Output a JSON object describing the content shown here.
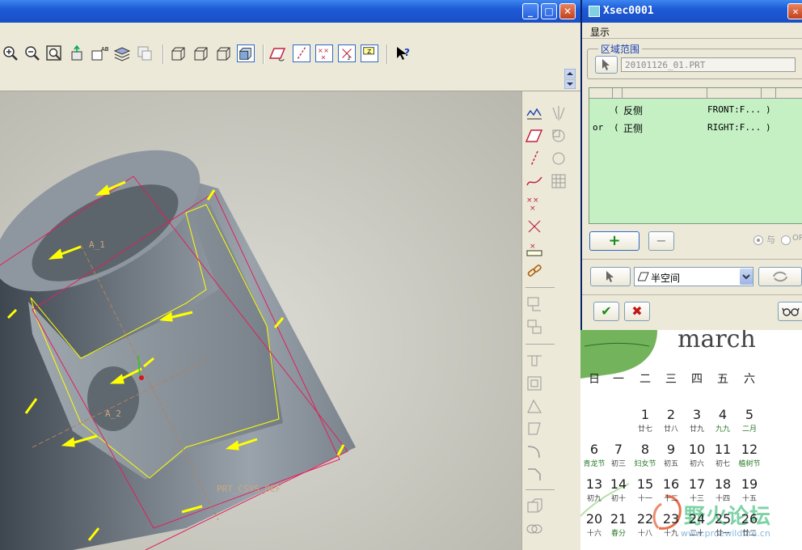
{
  "main_window": {
    "controls": {
      "min": "_",
      "max": "□",
      "close": "✕"
    }
  },
  "viewport": {
    "labels": {
      "datum_a1": "A_1",
      "datum_a2": "A_2",
      "csys": "PRT_CSYS_DEF"
    },
    "colors": {
      "accent_yellow": "#ffff00",
      "outline_red": "#e0205a",
      "body": "#8a929a"
    }
  },
  "dialog": {
    "title": "Xsec0001",
    "menu": "显示",
    "group_label": "区域范围",
    "part_field": "20101126_01.PRT",
    "rows": [
      {
        "op": "",
        "paren": "(",
        "side": "反侧",
        "ref": "FRONT:F...",
        "close": ")"
      },
      {
        "op": "or",
        "paren": "(",
        "side": "正侧",
        "ref": "RIGHT:F...",
        "close": ")"
      }
    ],
    "add_label": "+",
    "remove_label": "−",
    "radio_and": "与",
    "radio_or": "OR",
    "halfspace": "半空间",
    "ok": "✔",
    "cancel": "✖"
  },
  "calendar": {
    "month": "march",
    "weekdays": [
      "日",
      "一",
      "二",
      "三",
      "四",
      "五",
      "六"
    ],
    "weeks": [
      [
        {
          "d": "",
          "s": ""
        },
        {
          "d": "",
          "s": ""
        },
        {
          "d": "1",
          "s": "廿七"
        },
        {
          "d": "2",
          "s": "廿八"
        },
        {
          "d": "3",
          "s": "廿九"
        },
        {
          "d": "4",
          "s": "九九"
        },
        {
          "d": "5",
          "s": "二月"
        }
      ],
      [
        {
          "d": "6",
          "s": "青龙节"
        },
        {
          "d": "7",
          "s": "初三"
        },
        {
          "d": "8",
          "s": "妇女节"
        },
        {
          "d": "9",
          "s": "初五"
        },
        {
          "d": "10",
          "s": "初六"
        },
        {
          "d": "11",
          "s": "初七"
        },
        {
          "d": "12",
          "s": "植树节"
        }
      ],
      [
        {
          "d": "13",
          "s": "初九"
        },
        {
          "d": "14",
          "s": "初十"
        },
        {
          "d": "15",
          "s": "十一"
        },
        {
          "d": "16",
          "s": "十二"
        },
        {
          "d": "17",
          "s": "十三"
        },
        {
          "d": "18",
          "s": "十四"
        },
        {
          "d": "19",
          "s": "十五"
        }
      ],
      [
        {
          "d": "20",
          "s": "十六"
        },
        {
          "d": "21",
          "s": "春分"
        },
        {
          "d": "22",
          "s": "十八"
        },
        {
          "d": "23",
          "s": "十九"
        },
        {
          "d": "24",
          "s": "二十"
        },
        {
          "d": "25",
          "s": "廿一"
        },
        {
          "d": "26",
          "s": "廿二"
        }
      ]
    ],
    "watermark": "野火论坛",
    "watermark_url": "www.proewildfire.cn"
  }
}
